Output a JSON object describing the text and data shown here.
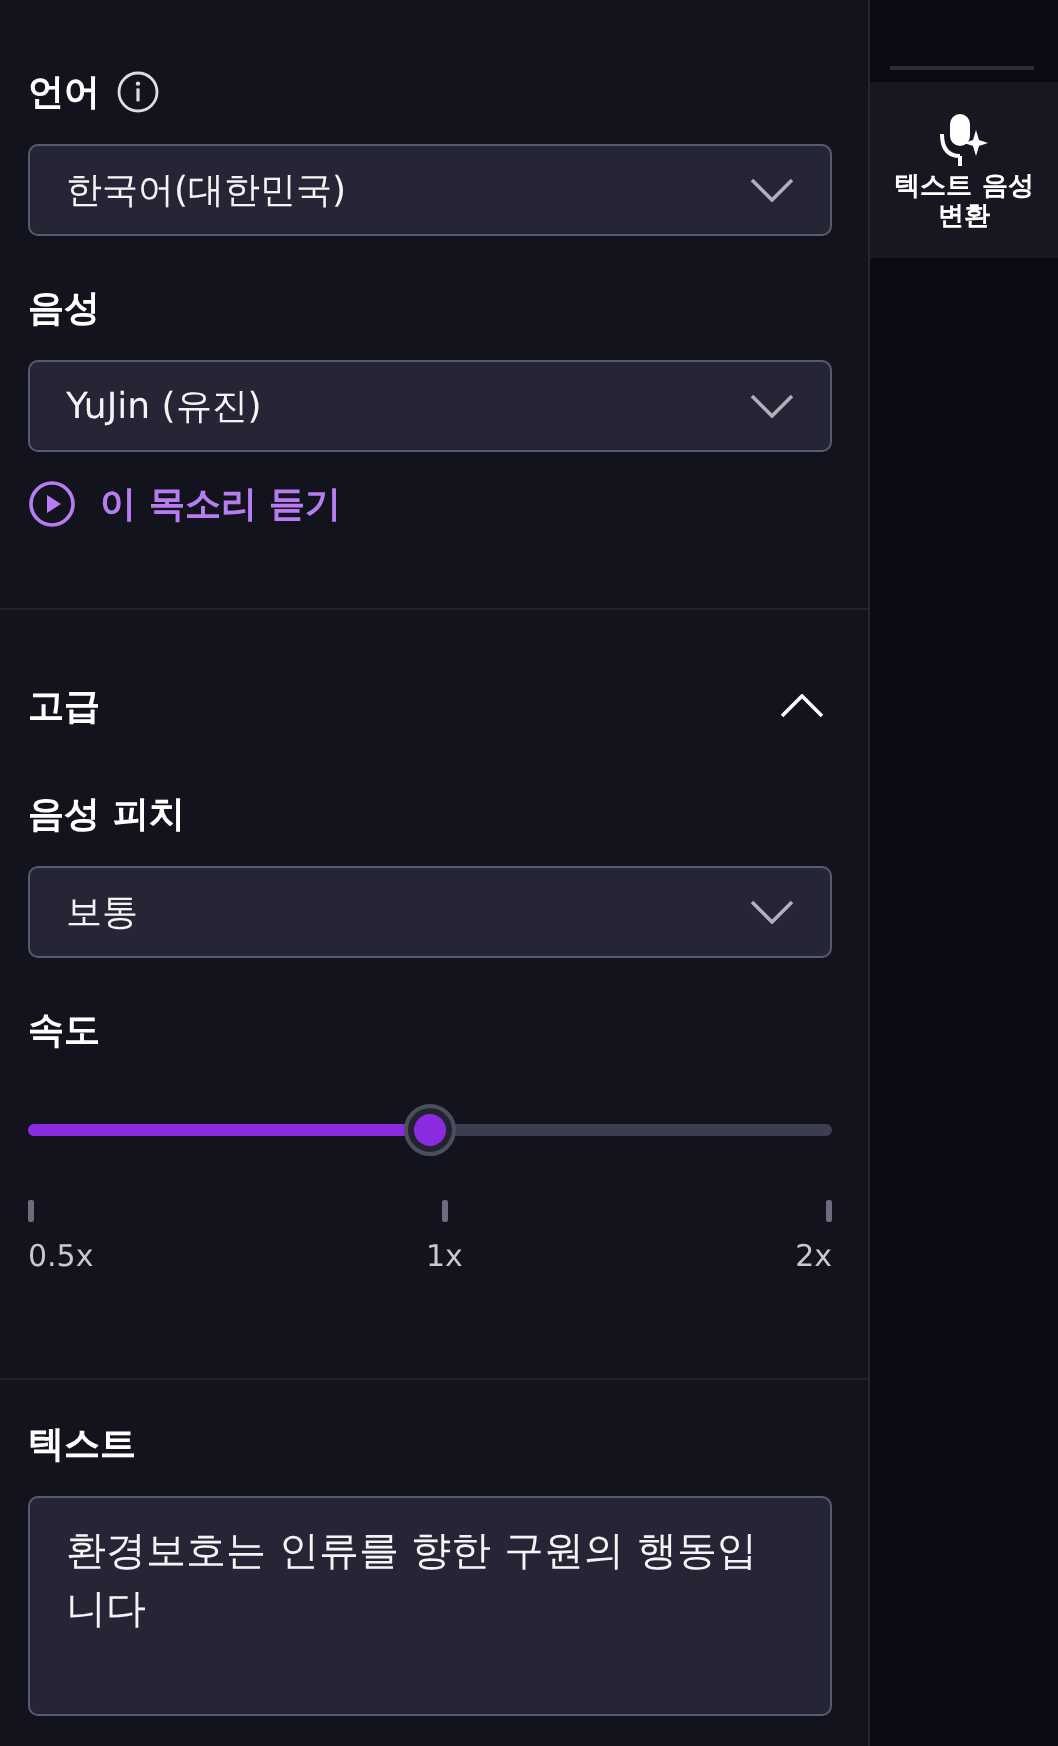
{
  "language": {
    "label": "언어",
    "value": "한국어(대한민국)"
  },
  "voice": {
    "label": "음성",
    "value": "YuJin (유진)",
    "listen_link": "이 목소리 듣기"
  },
  "advanced": {
    "title": "고급",
    "expanded": true,
    "pitch": {
      "label": "음성 피치",
      "value": "보통"
    },
    "speed": {
      "label": "속도",
      "level": 0.5,
      "ticks": [
        "0.5x",
        "1x",
        "2x"
      ]
    }
  },
  "text": {
    "label": "텍스트",
    "value": "환경보호는 인류를 향한 구원의 행동입니다"
  },
  "sidebar": {
    "items": [
      {
        "label": "텍스트 음성 변환",
        "selected": true
      }
    ]
  }
}
